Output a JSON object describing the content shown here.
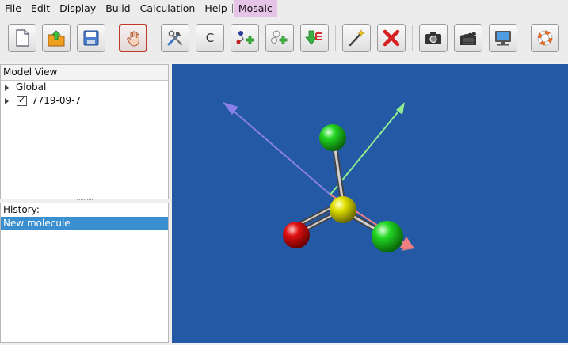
{
  "menu": {
    "items": [
      "File",
      "Edit",
      "Display",
      "Build",
      "Calculation",
      "Help"
    ],
    "extra": "Mosaic"
  },
  "toolbar": {
    "buttons": [
      {
        "name": "new-icon"
      },
      {
        "name": "open-icon"
      },
      {
        "name": "save-icon"
      },
      {
        "name": "hand-navigate-icon",
        "active": true
      },
      {
        "name": "build-tools-icon"
      },
      {
        "name": "element-c-icon",
        "label": "C"
      },
      {
        "name": "add-atom-icon"
      },
      {
        "name": "add-hydrogens-icon"
      },
      {
        "name": "extensions-icon"
      },
      {
        "name": "magic-wand-icon"
      },
      {
        "name": "delete-icon"
      },
      {
        "name": "camera-icon"
      },
      {
        "name": "clapperboard-icon"
      },
      {
        "name": "monitor-icon"
      },
      {
        "name": "lifebuoy-icon"
      }
    ]
  },
  "model_view": {
    "title": "Model View",
    "items": [
      {
        "label": "Global",
        "checked": false
      },
      {
        "label": "7719-09-7",
        "checked": true
      }
    ],
    "checkmark": "✓"
  },
  "history": {
    "label": "History:",
    "items": [
      "New molecule"
    ]
  },
  "colors": {
    "viewport_bg": "#2459a5",
    "selection": "#3a8fd0",
    "menu_highlight": "#e6c4e8",
    "atom_sulfur": "#e1e000",
    "atom_chlorine": "#22d622",
    "atom_oxygen": "#e01010",
    "axis_x": "#f08080",
    "axis_y": "#90ee90",
    "axis_z": "#8a7fe8"
  }
}
